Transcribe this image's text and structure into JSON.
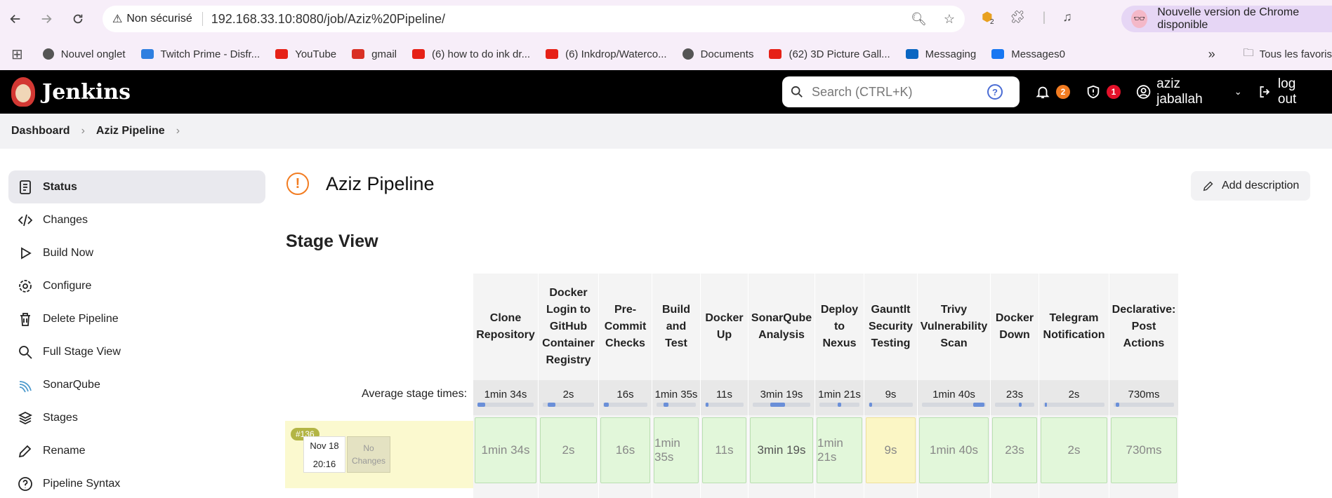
{
  "browser": {
    "security_label": "Non sécurisé",
    "url": "192.168.33.10:8080/job/Aziz%20Pipeline/",
    "ext_badge": "2",
    "update_label": "Nouvelle version de Chrome disponible"
  },
  "bookmarks": {
    "items": [
      {
        "label": "Nouvel onglet",
        "icon": "globe-icon",
        "color": "#555555"
      },
      {
        "label": "Twitch Prime - Disfr...",
        "icon": "crown-icon",
        "color": "#2f7fe0"
      },
      {
        "label": "YouTube",
        "icon": "youtube-icon",
        "color": "#e62117"
      },
      {
        "label": "gmail",
        "icon": "gmail-icon",
        "color": "#d93025"
      },
      {
        "label": "(6) how to do ink dr...",
        "icon": "youtube-icon",
        "color": "#e62117"
      },
      {
        "label": "(6) Inkdrop/Waterco...",
        "icon": "youtube-icon",
        "color": "#e62117"
      },
      {
        "label": "Documents",
        "icon": "globe-icon",
        "color": "#555555"
      },
      {
        "label": "(62) 3D Picture Gall...",
        "icon": "youtube-icon",
        "color": "#e62117"
      },
      {
        "label": "Messaging",
        "icon": "linkedin-icon",
        "color": "#0a66c2"
      },
      {
        "label": "Messages0",
        "icon": "facebook-icon",
        "color": "#1877f2"
      }
    ],
    "all_bookmarks": "Tous les favoris"
  },
  "jenkins": {
    "logo_text": "Jenkins",
    "search_placeholder": "Search (CTRL+K)",
    "help": "?",
    "notifications_count": "2",
    "security_count": "1",
    "user": "aziz jaballah",
    "logout": "log out"
  },
  "breadcrumb": {
    "dashboard": "Dashboard",
    "job": "Aziz Pipeline"
  },
  "sidebar": {
    "items": [
      {
        "label": "Status",
        "icon": "document-icon"
      },
      {
        "label": "Changes",
        "icon": "code-icon"
      },
      {
        "label": "Build Now",
        "icon": "play-icon"
      },
      {
        "label": "Configure",
        "icon": "gear-icon"
      },
      {
        "label": "Delete Pipeline",
        "icon": "trash-icon"
      },
      {
        "label": "Full Stage View",
        "icon": "search-icon"
      },
      {
        "label": "SonarQube",
        "icon": "sonarqube-icon"
      },
      {
        "label": "Stages",
        "icon": "layers-icon"
      },
      {
        "label": "Rename",
        "icon": "pencil-icon"
      },
      {
        "label": "Pipeline Syntax",
        "icon": "help-icon"
      }
    ]
  },
  "main": {
    "title": "Aziz Pipeline",
    "add_description": "Add description",
    "stage_view_title": "Stage View",
    "avg_label": "Average stage times:"
  },
  "stages": [
    {
      "name": "Clone Repository",
      "avg": "1min 34s",
      "cell": "1min 34s"
    },
    {
      "name": "Docker Login to GitHub Container Registry",
      "avg": "2s",
      "cell": "2s"
    },
    {
      "name": "Pre-Commit Checks",
      "avg": "16s",
      "cell": "16s"
    },
    {
      "name": "Build and Test",
      "avg": "1min 35s",
      "cell": "1min 35s"
    },
    {
      "name": "Docker Up",
      "avg": "11s",
      "cell": "11s"
    },
    {
      "name": "SonarQube Analysis",
      "avg": "3min 19s",
      "cell": "3min 19s"
    },
    {
      "name": "Deploy to Nexus",
      "avg": "1min 21s",
      "cell": "1min 21s"
    },
    {
      "name": "Gauntlt Security Testing",
      "avg": "9s",
      "cell": "9s"
    },
    {
      "name": "Trivy Vulnerability Scan",
      "avg": "1min 40s",
      "cell": "1min 40s"
    },
    {
      "name": "Docker Down",
      "avg": "23s",
      "cell": "23s"
    },
    {
      "name": "Telegram Notification",
      "avg": "2s",
      "cell": "2s"
    },
    {
      "name": "Declarative: Post Actions",
      "avg": "730ms",
      "cell": "730ms"
    }
  ],
  "run": {
    "number": "#136",
    "date": "Nov 18",
    "time": "20:16",
    "changes": "No Changes"
  },
  "colors": {
    "success_cell": "#e2f7da",
    "unstable_cell": "#fbf6c5",
    "accent_warning": "#f27c21"
  }
}
